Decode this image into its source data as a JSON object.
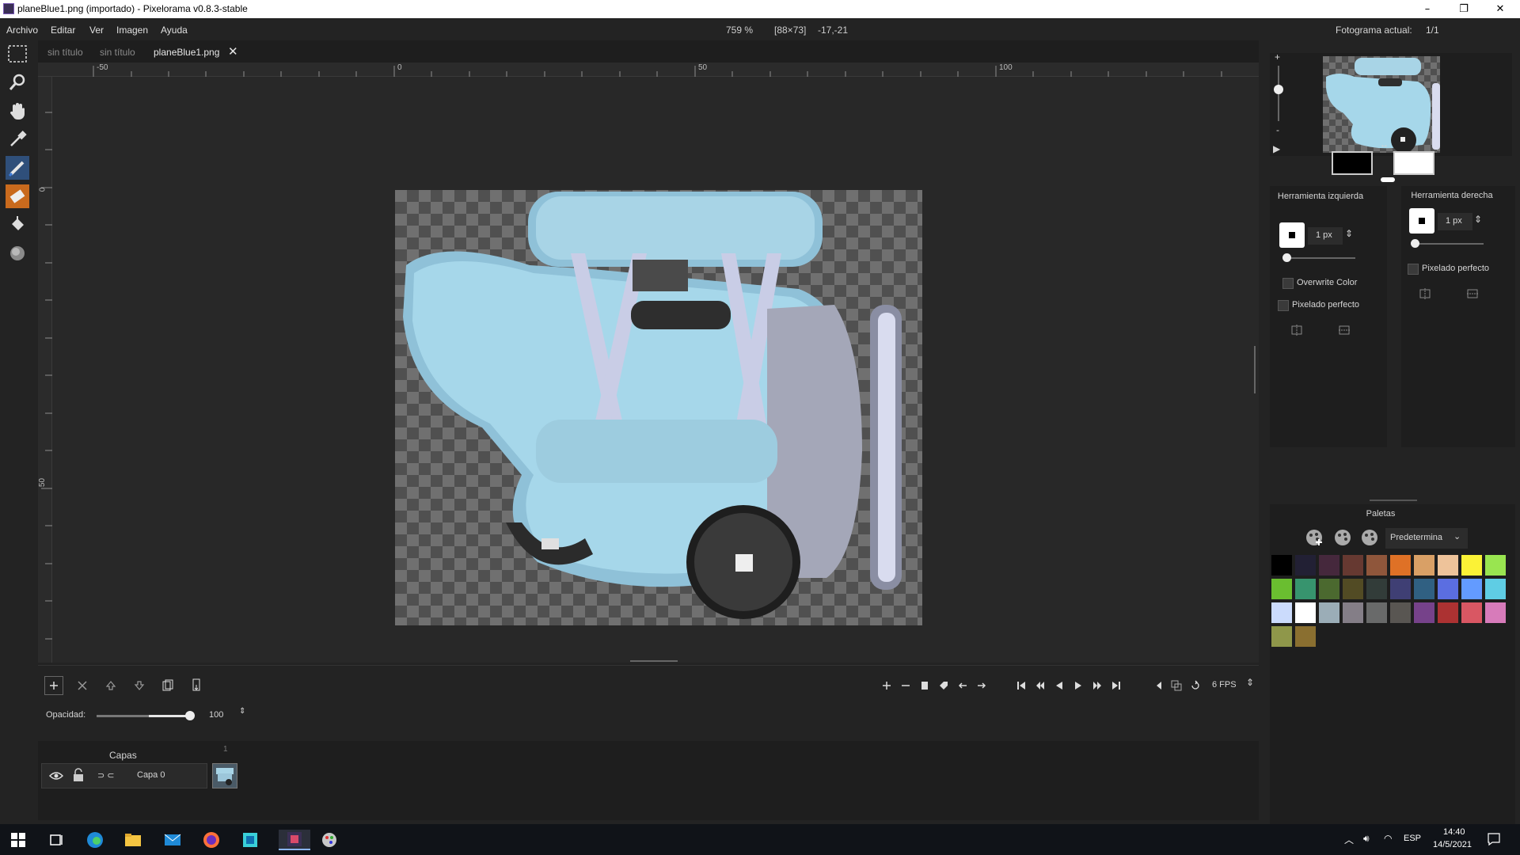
{
  "window": {
    "title": "planeBlue1.png (importado) - Pixelorama v0.8.3-stable",
    "minimize_label": "–",
    "restore_label": "❐",
    "close_label": "✕"
  },
  "menu": {
    "items": [
      "Archivo",
      "Editar",
      "Ver",
      "Imagen",
      "Ayuda"
    ],
    "zoom": "759 %",
    "size": "[88×73]",
    "coords": "-17,-21",
    "current_frame_label": "Fotograma actual:",
    "current_frame_value": "1/1"
  },
  "tabs": [
    {
      "label": "sin título",
      "active": false
    },
    {
      "label": "sin título",
      "active": false
    },
    {
      "label": "planeBlue1.png",
      "active": true
    }
  ],
  "ruler": {
    "h_labels": [
      "-50",
      "0",
      "50",
      "100"
    ],
    "v_labels": [
      "0",
      "50"
    ]
  },
  "left_tool": {
    "header": "Herramienta izquierda",
    "size_value": "1 px",
    "overwrite_label": "Overwrite Color",
    "pixel_perfect_label": "Pixelado perfecto"
  },
  "right_tool": {
    "header": "Herramienta derecha",
    "size_value": "1 px",
    "pixel_perfect_label": "Pixelado perfecto"
  },
  "palettes": {
    "header": "Paletas",
    "selected": "Predetermina",
    "colors": [
      "#000000",
      "#222034",
      "#45283c",
      "#663931",
      "#8f563b",
      "#df7126",
      "#d9a066",
      "#eec39a",
      "#fbf236",
      "#99e550",
      "#6abe30",
      "#37946e",
      "#4b692f",
      "#524b24",
      "#323c39",
      "#3f3f74",
      "#306082",
      "#5b6ee1",
      "#639bff",
      "#5fcde4",
      "#cbdbfc",
      "#ffffff",
      "#9badb7",
      "#847e87",
      "#696a6a",
      "#595652",
      "#76428a",
      "#ac3232",
      "#d95763",
      "#d77bba",
      "#8f974a",
      "#8a6f30"
    ]
  },
  "animation": {
    "opacity_label": "Opacidad:",
    "opacity_value": "100",
    "fps_value": "6 FPS"
  },
  "layers": {
    "header": "Capas",
    "frame_number": "1",
    "layer_name": "Capa 0"
  },
  "taskbar": {
    "time": "14:40",
    "date": "14/5/2021",
    "lang": "ESP"
  },
  "colors": {
    "accent": "#3d7bd9",
    "eraser": "#e07b22",
    "primary_color": "#000000",
    "secondary_color": "#ffffff"
  }
}
